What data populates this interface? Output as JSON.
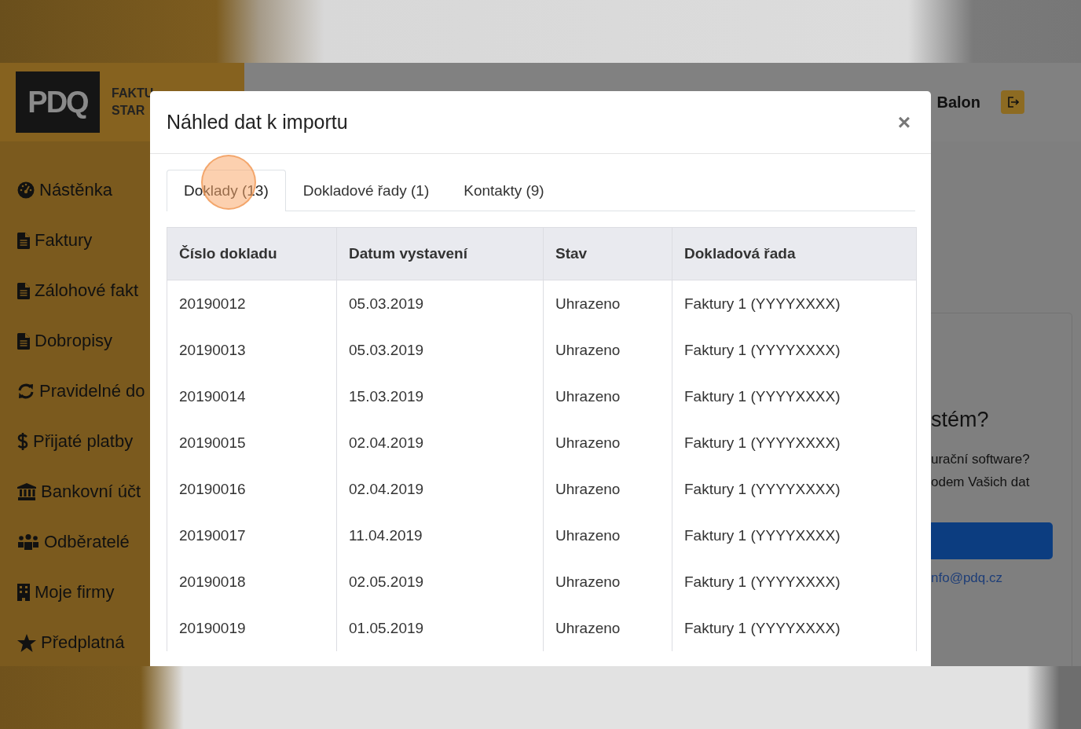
{
  "app": {
    "logo": {
      "mark": "PDQ",
      "tagline_lines": [
        "FAKTU",
        "STAR"
      ]
    },
    "user": {
      "name": "Balon"
    },
    "sidebar": {
      "items": [
        {
          "label": "Nástěnka",
          "kind": "gauge"
        },
        {
          "label": "Faktury",
          "kind": "file"
        },
        {
          "label": "Zálohové fakt",
          "kind": "file"
        },
        {
          "label": "Dobropisy",
          "kind": "file"
        },
        {
          "label": "Pravidelné do",
          "kind": "sync"
        },
        {
          "label": "Přijaté platby",
          "kind": "dollar"
        },
        {
          "label": "Bankovní účt",
          "kind": "bank"
        },
        {
          "label": "Odběratelé",
          "kind": "users"
        },
        {
          "label": "Moje firmy",
          "kind": "building"
        },
        {
          "label": "Předplatná",
          "kind": "star"
        }
      ]
    },
    "promo_card": {
      "title": "stém?",
      "lines": [
        "urační software?",
        "odem Vašich dat"
      ],
      "link": "nfo@pdq.cz"
    }
  },
  "modal": {
    "title": "Náhled dat k importu",
    "close": "×",
    "tabs": [
      {
        "label": "Doklady (13)",
        "selected": true
      },
      {
        "label": "Dokladové řady (1)",
        "selected": false
      },
      {
        "label": "Kontakty (9)",
        "selected": false
      }
    ],
    "table": {
      "columns": [
        "Číslo dokladu",
        "Datum vystavení",
        "Stav",
        "Dokladová řada"
      ],
      "rows": [
        [
          "20190012",
          "05.03.2019",
          "Uhrazeno",
          "Faktury 1 (YYYYXXXX)"
        ],
        [
          "20190013",
          "05.03.2019",
          "Uhrazeno",
          "Faktury 1 (YYYYXXXX)"
        ],
        [
          "20190014",
          "15.03.2019",
          "Uhrazeno",
          "Faktury 1 (YYYYXXXX)"
        ],
        [
          "20190015",
          "02.04.2019",
          "Uhrazeno",
          "Faktury 1 (YYYYXXXX)"
        ],
        [
          "20190016",
          "02.04.2019",
          "Uhrazeno",
          "Faktury 1 (YYYYXXXX)"
        ],
        [
          "20190017",
          "11.04.2019",
          "Uhrazeno",
          "Faktury 1 (YYYYXXXX)"
        ],
        [
          "20190018",
          "02.05.2019",
          "Uhrazeno",
          "Faktury 1 (YYYYXXXX)"
        ],
        [
          "20190019",
          "01.05.2019",
          "Uhrazeno",
          "Faktury 1 (YYYYXXXX)"
        ]
      ]
    }
  }
}
